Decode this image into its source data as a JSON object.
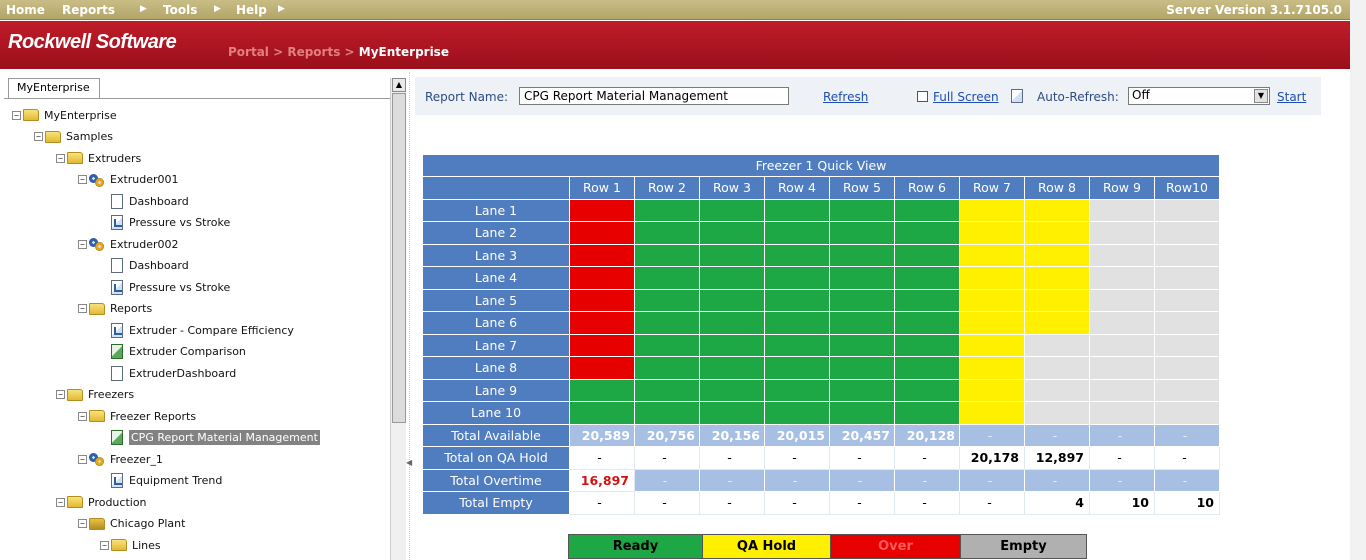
{
  "menu": {
    "home": "Home",
    "reports": "Reports",
    "tools": "Tools",
    "help": "Help",
    "server_version": "Server Version 3.1.7105.0"
  },
  "brand": {
    "name": "Rockwell Software",
    "breadcrumb_portal": "Portal",
    "breadcrumb_reports": "Reports",
    "breadcrumb_current": "MyEnterprise",
    "separator": " > "
  },
  "left_pane": {
    "tab_label": "MyEnterprise",
    "tree": [
      {
        "label": "MyEnterprise",
        "icon": "folder-icon"
      },
      {
        "label": "Samples",
        "icon": "folder-icon"
      },
      {
        "label": "Extruders",
        "icon": "folder-icon"
      },
      {
        "label": "Extruder001",
        "icon": "gear-icon"
      },
      {
        "label": "Dashboard",
        "icon": "document-icon"
      },
      {
        "label": "Pressure vs Stroke",
        "icon": "report-icon"
      },
      {
        "label": "Extruder002",
        "icon": "gear-icon"
      },
      {
        "label": "Dashboard",
        "icon": "document-icon"
      },
      {
        "label": "Pressure vs Stroke",
        "icon": "report-icon"
      },
      {
        "label": "Reports",
        "icon": "folder-icon"
      },
      {
        "label": "Extruder - Compare Efficiency",
        "icon": "report-icon"
      },
      {
        "label": "Extruder Comparison",
        "icon": "excel-icon"
      },
      {
        "label": "ExtruderDashboard",
        "icon": "document-icon"
      },
      {
        "label": "Freezers",
        "icon": "folder-icon"
      },
      {
        "label": "Freezer Reports",
        "icon": "folder-icon"
      },
      {
        "label": "CPG Report Material Management",
        "icon": "excel-icon",
        "selected": true
      },
      {
        "label": "Freezer_1",
        "icon": "gear-icon"
      },
      {
        "label": "Equipment Trend",
        "icon": "report-icon"
      },
      {
        "label": "Production",
        "icon": "folder-icon"
      },
      {
        "label": "Chicago Plant",
        "icon": "plant-folder-icon"
      },
      {
        "label": "Lines",
        "icon": "folder-icon"
      }
    ]
  },
  "toolbar": {
    "report_name_label": "Report Name:",
    "report_name_value": "CPG Report Material Management",
    "refresh": "Refresh",
    "full_screen": "Full Screen",
    "auto_refresh_label": "Auto-Refresh:",
    "auto_refresh_value": "Off",
    "start": "Start"
  },
  "freezer_table": {
    "title": "Freezer 1 Quick View",
    "columns": [
      "Row 1",
      "Row 2",
      "Row 3",
      "Row 4",
      "Row 5",
      "Row 6",
      "Row 7",
      "Row 8",
      "Row 9",
      "Row10"
    ],
    "lanes": [
      {
        "label": "Lane 1",
        "status": [
          "over",
          "ready",
          "ready",
          "ready",
          "ready",
          "ready",
          "qa_hold",
          "qa_hold",
          "empty",
          "empty"
        ]
      },
      {
        "label": "Lane 2",
        "status": [
          "over",
          "ready",
          "ready",
          "ready",
          "ready",
          "ready",
          "qa_hold",
          "qa_hold",
          "empty",
          "empty"
        ]
      },
      {
        "label": "Lane 3",
        "status": [
          "over",
          "ready",
          "ready",
          "ready",
          "ready",
          "ready",
          "qa_hold",
          "qa_hold",
          "empty",
          "empty"
        ]
      },
      {
        "label": "Lane 4",
        "status": [
          "over",
          "ready",
          "ready",
          "ready",
          "ready",
          "ready",
          "qa_hold",
          "qa_hold",
          "empty",
          "empty"
        ]
      },
      {
        "label": "Lane 5",
        "status": [
          "over",
          "ready",
          "ready",
          "ready",
          "ready",
          "ready",
          "qa_hold",
          "qa_hold",
          "empty",
          "empty"
        ]
      },
      {
        "label": "Lane 6",
        "status": [
          "over",
          "ready",
          "ready",
          "ready",
          "ready",
          "ready",
          "qa_hold",
          "qa_hold",
          "empty",
          "empty"
        ]
      },
      {
        "label": "Lane 7",
        "status": [
          "over",
          "ready",
          "ready",
          "ready",
          "ready",
          "ready",
          "qa_hold",
          "empty",
          "empty",
          "empty"
        ]
      },
      {
        "label": "Lane 8",
        "status": [
          "over",
          "ready",
          "ready",
          "ready",
          "ready",
          "ready",
          "qa_hold",
          "empty",
          "empty",
          "empty"
        ]
      },
      {
        "label": "Lane 9",
        "status": [
          "ready",
          "ready",
          "ready",
          "ready",
          "ready",
          "ready",
          "qa_hold",
          "empty",
          "empty",
          "empty"
        ]
      },
      {
        "label": "Lane 10",
        "status": [
          "ready",
          "ready",
          "ready",
          "ready",
          "ready",
          "ready",
          "qa_hold",
          "empty",
          "empty",
          "empty"
        ]
      }
    ],
    "totals": [
      {
        "label": "Total Available",
        "style": "blue",
        "values": [
          "20,589",
          "20,756",
          "20,156",
          "20,015",
          "20,457",
          "20,128",
          "-",
          "-",
          "-",
          "-"
        ]
      },
      {
        "label": "Total on QA Hold",
        "style": "white",
        "values": [
          "-",
          "-",
          "-",
          "-",
          "-",
          "-",
          "20,178",
          "12,897",
          "-",
          "-"
        ]
      },
      {
        "label": "Total Overtime",
        "style": "blue",
        "values": [
          "16,897",
          "-",
          "-",
          "-",
          "-",
          "-",
          "-",
          "-",
          "-",
          "-"
        ]
      },
      {
        "label": "Total Empty",
        "style": "white",
        "values": [
          "-",
          "-",
          "-",
          "-",
          "-",
          "-",
          "-",
          "4",
          "10",
          "10"
        ]
      }
    ]
  },
  "legend": {
    "ready": "Ready",
    "qa_hold": "QA Hold",
    "over": "Over",
    "empty": "Empty"
  },
  "colors": {
    "ready": "#1ea745",
    "qa_hold": "#fff000",
    "over": "#e60000",
    "empty": "#e1e1e1",
    "header_blue": "#4f7dc0",
    "brand_red": "#b01421"
  }
}
